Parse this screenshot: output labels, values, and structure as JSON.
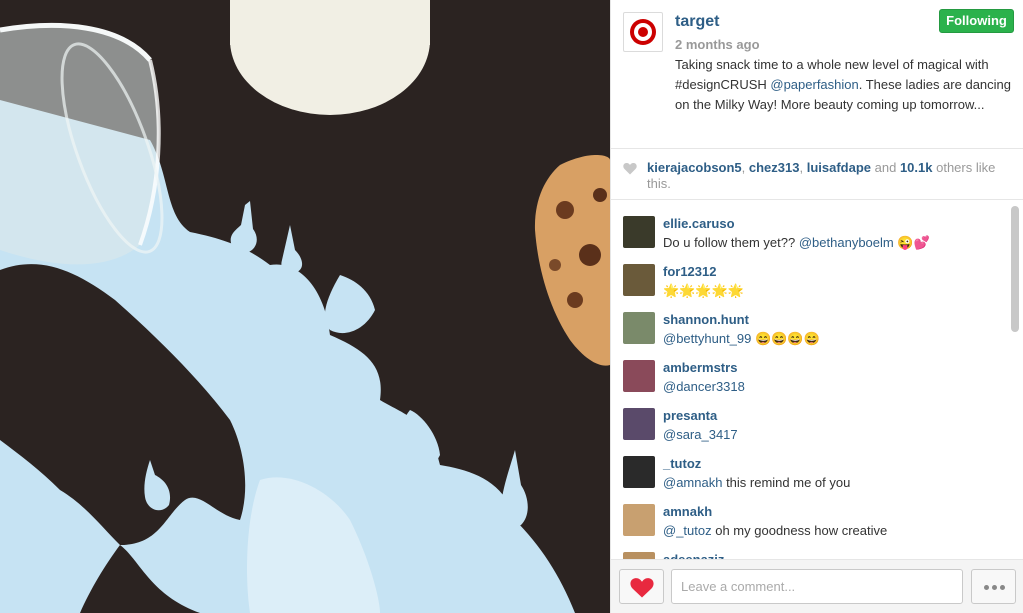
{
  "post": {
    "username": "target",
    "time": "2 months ago",
    "follow_label": "Following",
    "caption_part1": "Taking snack time to a whole new level of magical with #designCRUSH ",
    "caption_mention": "@paperfashion",
    "caption_part2": ". These ladies are dancing on the Milky Way! More beauty coming up tomorrow..."
  },
  "likes": {
    "user1": "kierajacobson5",
    "sep1": ", ",
    "user2": "chez313",
    "sep2": ", ",
    "user3": "luisafdape",
    "and_text": " and ",
    "count": "10.1k",
    "suffix": " others like this."
  },
  "comments": [
    {
      "user": "ellie.caruso",
      "pre": "Do u follow them yet?? ",
      "mention": "@bethanyboelm",
      "post": " 😜💕",
      "avatar_color": "#3a3a2a"
    },
    {
      "user": "for12312",
      "pre": "",
      "mention": "",
      "post": "🌟🌟🌟🌟🌟",
      "avatar_color": "#6a5a3a"
    },
    {
      "user": "shannon.hunt",
      "pre": "",
      "mention": "@bettyhunt_99",
      "post": " 😄😄😄😄",
      "avatar_color": "#7a8a6a"
    },
    {
      "user": "ambermstrs",
      "pre": "",
      "mention": "@dancer3318",
      "post": "",
      "avatar_color": "#8a4a5a"
    },
    {
      "user": "presanta",
      "pre": "",
      "mention": "@sara_3417",
      "post": "",
      "avatar_color": "#5a4a6a"
    },
    {
      "user": "_tutoz",
      "pre": "",
      "mention": "@amnakh",
      "post": " this remind me of you",
      "avatar_color": "#2a2a2a"
    },
    {
      "user": "amnakh",
      "pre": "",
      "mention": "@_tutoz",
      "post": " oh my goodness how creative",
      "avatar_color": "#c8a070"
    },
    {
      "user": "adeenaziz",
      "pre": "",
      "mention": "",
      "post": "",
      "avatar_color": "#b89060"
    }
  ],
  "footer": {
    "comment_placeholder": "Leave a comment..."
  },
  "icons": {
    "like_small": "heart-icon",
    "like_button": "heart-icon",
    "more": "more-dots-icon",
    "brand": "target-logo-icon"
  },
  "colors": {
    "username": "#2e5e86",
    "follow_green": "#2bb24c",
    "like_red": "#e8293f"
  }
}
